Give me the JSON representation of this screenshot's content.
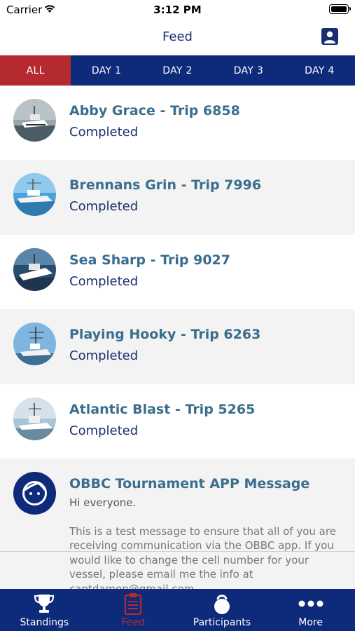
{
  "status_bar": {
    "carrier": "Carrier",
    "time": "3:12 PM"
  },
  "nav": {
    "title": "Feed",
    "profile_icon": "person-icon"
  },
  "tabs": [
    {
      "label": "ALL",
      "active": true
    },
    {
      "label": "DAY 1",
      "active": false
    },
    {
      "label": "DAY 2",
      "active": false
    },
    {
      "label": "DAY 3",
      "active": false
    },
    {
      "label": "DAY 4",
      "active": false
    }
  ],
  "feed": {
    "items": [
      {
        "title": "Abby Grace - Trip 6858",
        "status": "Completed"
      },
      {
        "title": "Brennans Grin - Trip 7996",
        "status": "Completed"
      },
      {
        "title": "Sea Sharp - Trip 9027",
        "status": "Completed"
      },
      {
        "title": "Playing Hooky - Trip 6263",
        "status": "Completed"
      },
      {
        "title": "Atlantic Blast - Trip 5265",
        "status": "Completed"
      }
    ],
    "message": {
      "title": "OBBC Tournament APP Message",
      "greeting": "Hi everyone.",
      "body": "This is a test message to ensure that all of you are receiving communication via the OBBC app. If you would like to change the cell number for your vessel, please email me the info at captdamon@gmail.com"
    }
  },
  "tab_bar": [
    {
      "label": "Standings",
      "icon": "trophy-icon",
      "active": false
    },
    {
      "label": "Feed",
      "icon": "clipboard-icon",
      "active": true
    },
    {
      "label": "Participants",
      "icon": "kettlebell-icon",
      "active": false
    },
    {
      "label": "More",
      "icon": "more-dots-icon",
      "active": false
    }
  ],
  "colors": {
    "navy": "#0e2a7a",
    "active_red": "#b52a2f",
    "title_blue": "#3a6d8e",
    "status_navy": "#1b2f70"
  }
}
